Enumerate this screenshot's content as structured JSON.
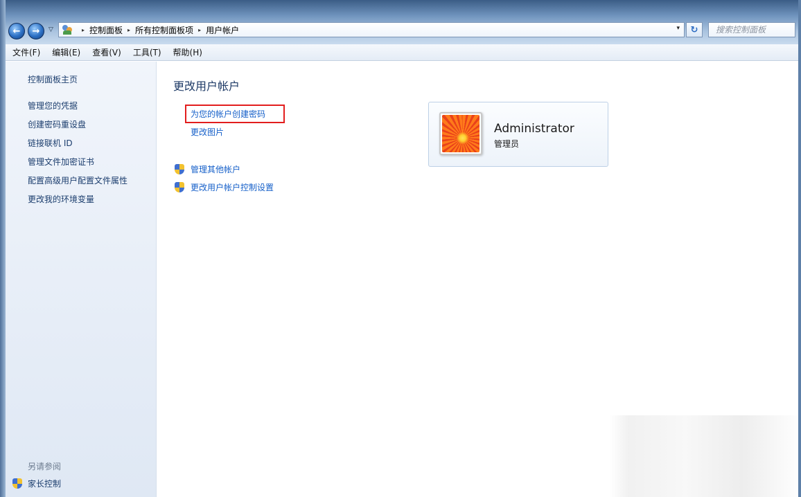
{
  "nav": {
    "back_glyph": "←",
    "forward_glyph": "→",
    "dropdown_glyph": "▽",
    "refresh_glyph": "↻"
  },
  "address": {
    "icon": "control-panel-icon",
    "breadcrumbs": [
      "控制面板",
      "所有控制面板项",
      "用户帐户"
    ],
    "separator": "▸",
    "dropdown_glyph": "▾"
  },
  "search": {
    "placeholder": "搜索控制面板"
  },
  "menu": {
    "items": [
      "文件(F)",
      "编辑(E)",
      "查看(V)",
      "工具(T)",
      "帮助(H)"
    ]
  },
  "sidebar": {
    "home": "控制面板主页",
    "links": [
      "管理您的凭据",
      "创建密码重设盘",
      "链接联机 ID",
      "管理文件加密证书",
      "配置高级用户配置文件属性",
      "更改我的环境变量"
    ],
    "see_also": "另请参阅",
    "parental_control": "家长控制"
  },
  "main": {
    "title": "更改用户帐户",
    "create_password": "为您的帐户创建密码",
    "change_picture": "更改图片",
    "manage_other": "管理其他帐户",
    "uac_settings": "更改用户帐户控制设置"
  },
  "account": {
    "name": "Administrator",
    "role": "管理员"
  },
  "colors": {
    "link": "#1660c9",
    "highlight": "#e21d1d",
    "title": "#1e3a66"
  }
}
